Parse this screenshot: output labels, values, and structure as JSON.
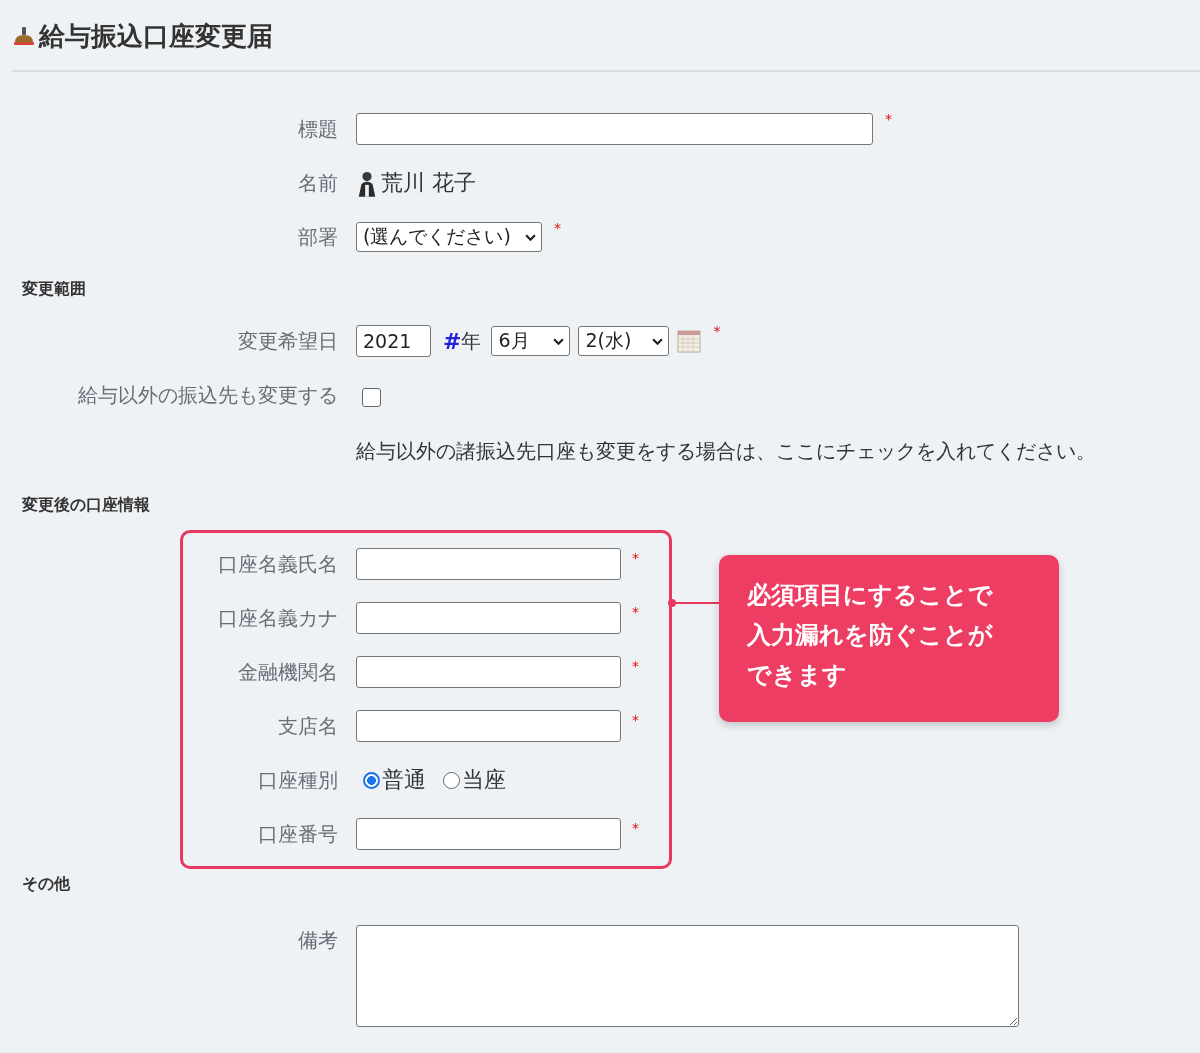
{
  "title": "給与振込口座変更届",
  "required_mark": "*",
  "rows": [
    {
      "kind": "text",
      "label": "標題",
      "required": true
    },
    {
      "kind": "user",
      "label": "名前",
      "value": "荒川 花子",
      "required": false
    },
    {
      "kind": "select",
      "label": "部署",
      "value": "(選んでください)",
      "required": true
    },
    {
      "kind": "heading",
      "label": "変更範囲"
    },
    {
      "kind": "date",
      "label": "変更希望日",
      "year": "2021",
      "year_mark": "#",
      "year_unit": "年",
      "month": "6月",
      "day": "2(水)",
      "required": true
    },
    {
      "kind": "checkbox",
      "label": "給与以外の振込先も変更する",
      "checked": false
    },
    {
      "kind": "note",
      "label": "給与以外の諸振込先口座も変更をする場合は、ここにチェックを入れてください。"
    },
    {
      "kind": "heading",
      "label": "変更後の口座情報"
    },
    {
      "kind": "group",
      "callout": [
        "必須項目にすることで",
        "入力漏れを防ぐことが",
        "できます"
      ],
      "rows": [
        {
          "kind": "text",
          "label": "口座名義氏名",
          "required": true
        },
        {
          "kind": "text",
          "label": "口座名義カナ",
          "required": true
        },
        {
          "kind": "text",
          "label": "金融機関名",
          "required": true
        },
        {
          "kind": "text",
          "label": "支店名",
          "required": true
        },
        {
          "kind": "radio",
          "label": "口座種別",
          "options": [
            {
              "label": "普通",
              "selected": true
            },
            {
              "label": "当座",
              "selected": false
            }
          ]
        },
        {
          "kind": "text",
          "label": "口座番号",
          "required": true
        }
      ]
    },
    {
      "kind": "heading",
      "label": "その他"
    },
    {
      "kind": "textarea",
      "label": "備考",
      "required": false
    }
  ]
}
